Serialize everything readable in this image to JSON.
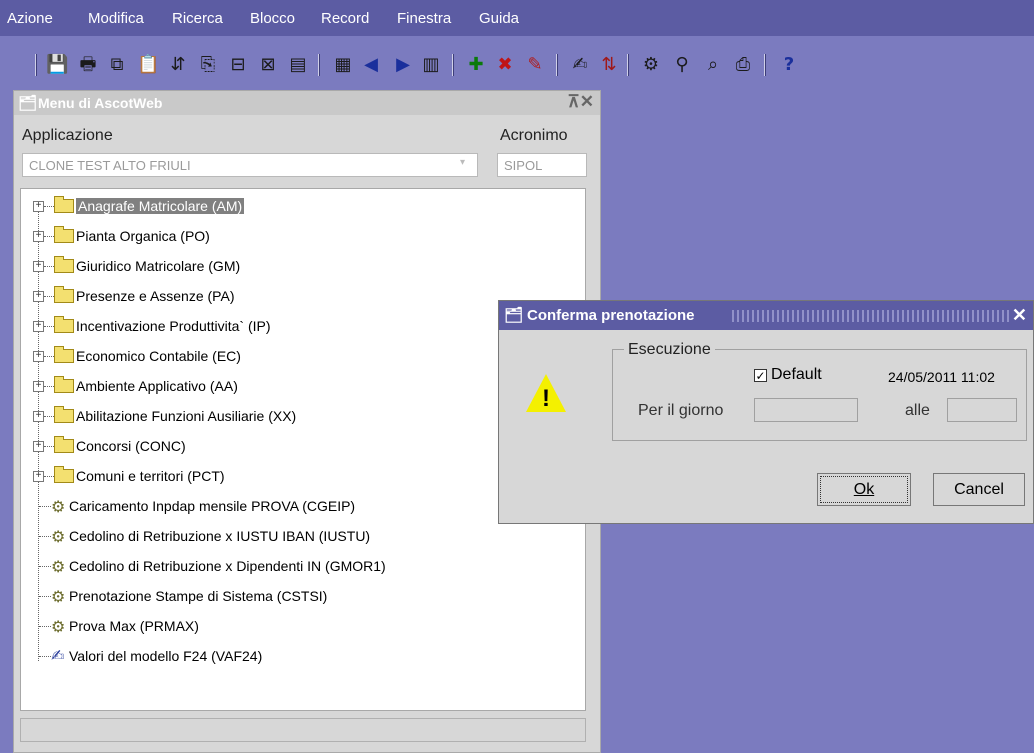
{
  "menubar": {
    "items": [
      "Azione",
      "Modifica",
      "Ricerca",
      "Blocco",
      "Record",
      "Finestra",
      "Guida"
    ]
  },
  "toolbar": {
    "icons": [
      "save-icon",
      "print-icon",
      "copy-icon",
      "paste-icon",
      "insert-icon",
      "duplicate-icon",
      "delete-icon",
      "clear-icon",
      "count-icon",
      "list-icon",
      "prev-icon",
      "next-icon",
      "grid-icon",
      "add-icon",
      "remove-icon",
      "edit-icon",
      "properties-icon",
      "sort-icon",
      "tools-icon",
      "find-icon",
      "query-icon",
      "export-icon",
      "help-icon"
    ]
  },
  "panel": {
    "title": "Menu di AscotWeb",
    "controls": "⊼✕",
    "app_label": "Applicazione",
    "acr_label": "Acronimo",
    "app_value": "CLONE TEST ALTO FRIULI",
    "acr_value": "SIPOL"
  },
  "tree": {
    "folders": [
      "Anagrafe Matricolare (AM)",
      "Pianta Organica (PO)",
      "Giuridico Matricolare (GM)",
      "Presenze e Assenze (PA)",
      "Incentivazione Produttivita` (IP)",
      "Economico Contabile (EC)",
      "Ambiente Applicativo (AA)",
      "Abilitazione Funzioni Ausiliarie (XX)",
      "Concorsi (CONC)",
      "Comuni e territori (PCT)"
    ],
    "leaves": [
      "Caricamento Inpdap mensile PROVA (CGEIP)",
      "Cedolino di Retribuzione x IUSTU IBAN (IUSTU)",
      "Cedolino di Retribuzione x Dipendenti IN (GMOR1)",
      "Prenotazione Stampe di Sistema (CSTSI)",
      "Prova Max (PRMAX)",
      "Valori del modello F24 (VAF24)"
    ]
  },
  "dialog": {
    "title": "Conferma prenotazione",
    "group": "Esecuzione",
    "default_label": "Default",
    "default_checked": true,
    "datetime": "24/05/2011 11:02",
    "day_label": "Per il giorno",
    "time_label": "alle",
    "ok_label": "Ok",
    "cancel_label": "Cancel"
  }
}
